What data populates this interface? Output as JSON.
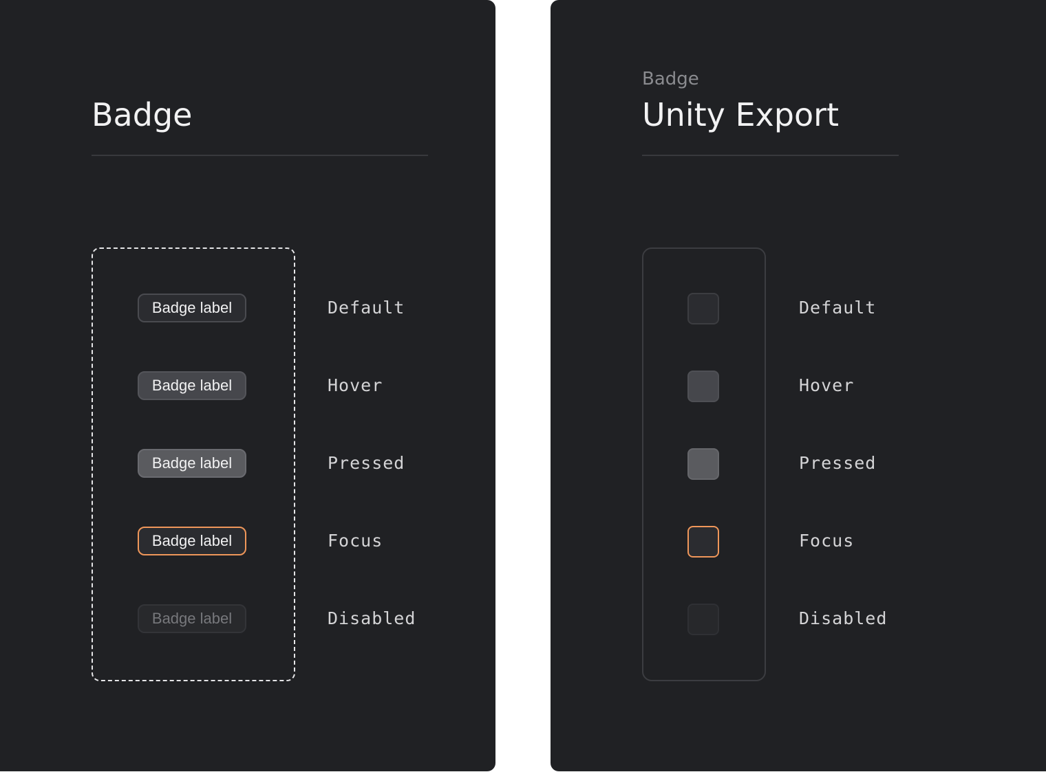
{
  "left_panel": {
    "title": "Badge",
    "badges": [
      {
        "label": "Badge label",
        "state": "Default"
      },
      {
        "label": "Badge label",
        "state": "Hover"
      },
      {
        "label": "Badge label",
        "state": "Pressed"
      },
      {
        "label": "Badge label",
        "state": "Focus"
      },
      {
        "label": "Badge label",
        "state": "Disabled"
      }
    ]
  },
  "right_panel": {
    "eyebrow": "Badge",
    "title": "Unity Export",
    "states": [
      "Default",
      "Hover",
      "Pressed",
      "Focus",
      "Disabled"
    ]
  },
  "colors": {
    "panel_background": "#202124",
    "focus_accent": "#f0975a",
    "text_primary": "#f2f2f3",
    "text_muted": "#8a8b8f"
  }
}
